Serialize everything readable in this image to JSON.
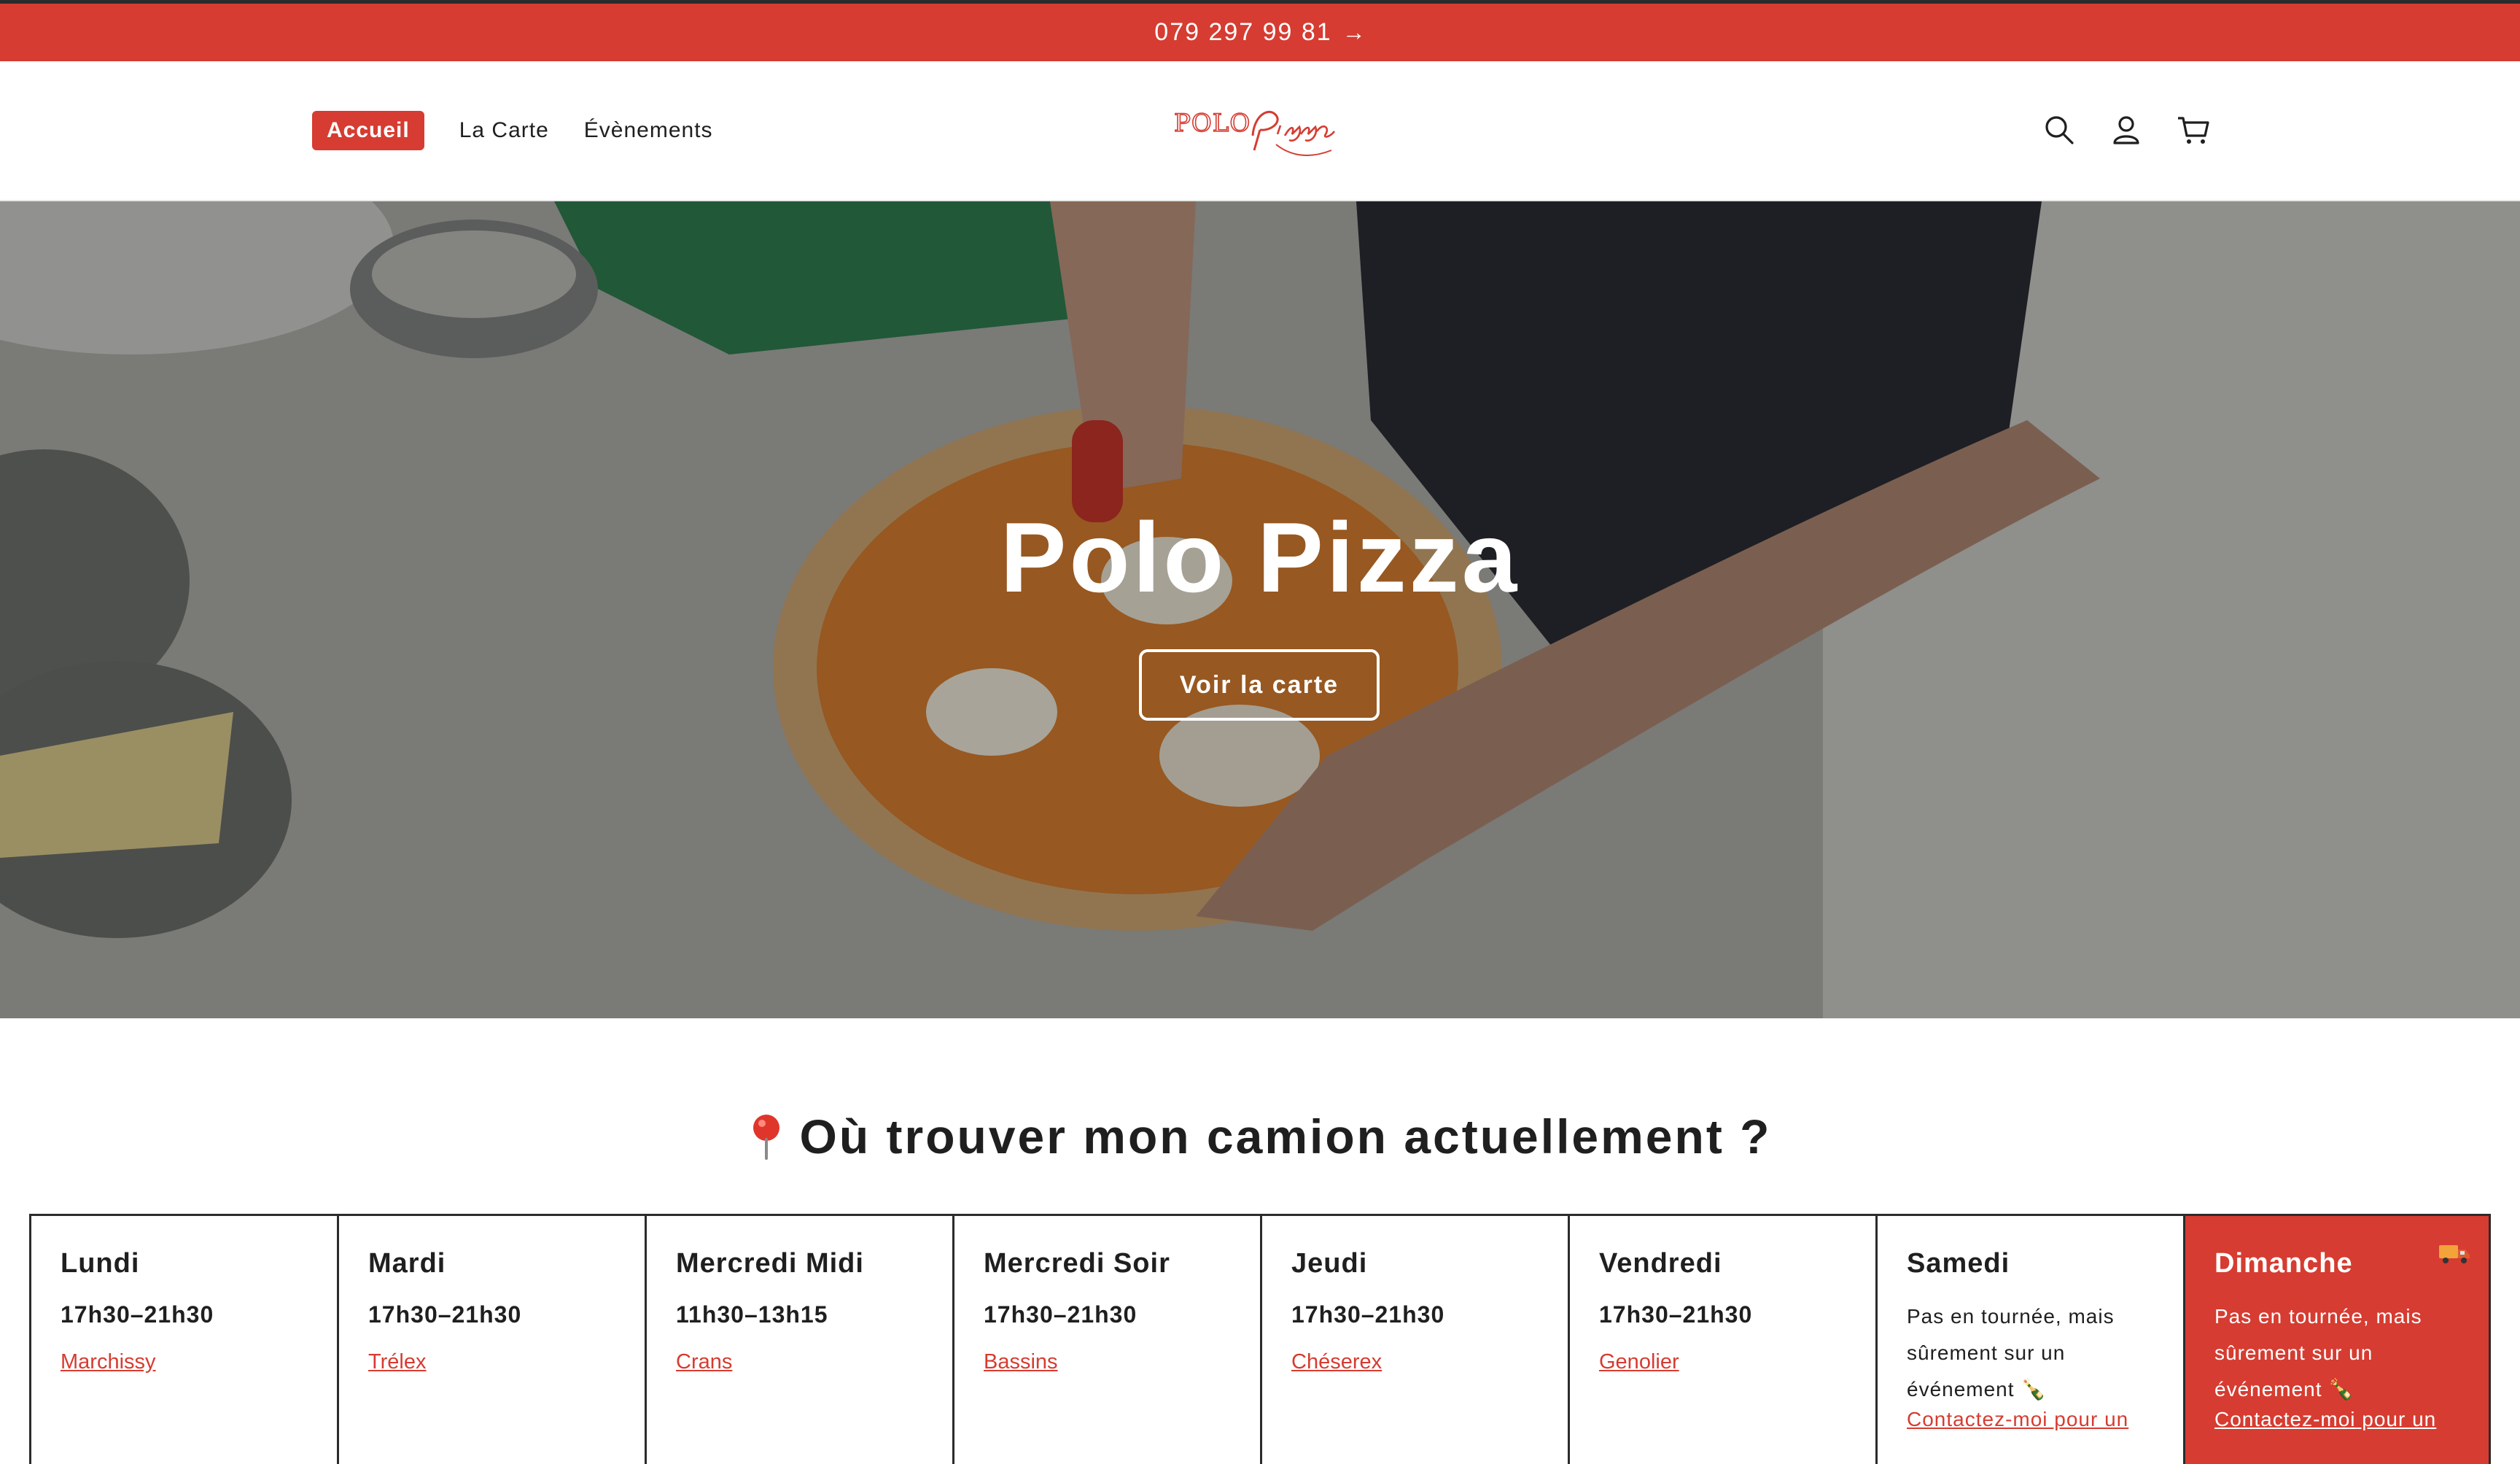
{
  "announcement": {
    "text": "079 297 99 81",
    "arrow": "→"
  },
  "nav": {
    "items": [
      {
        "label": "Accueil",
        "active": true
      },
      {
        "label": "La Carte",
        "active": false
      },
      {
        "label": "Évènements",
        "active": false
      }
    ]
  },
  "logo": {
    "text": "POLO Pizza"
  },
  "header_icons": [
    "search-icon",
    "account-icon",
    "cart-icon"
  ],
  "hero": {
    "title": "Polo Pizza",
    "button_label": "Voir la carte"
  },
  "locations": {
    "heading": "Où trouver mon camion actuellement ?",
    "heading_icon": "pin-icon",
    "days": [
      {
        "name": "Lundi",
        "hours": "17h30–21h30",
        "place": "Marchissy"
      },
      {
        "name": "Mardi",
        "hours": "17h30–21h30",
        "place": "Trélex"
      },
      {
        "name": "Mercredi Midi",
        "hours": "11h30–13h15",
        "place": "Crans"
      },
      {
        "name": "Mercredi Soir",
        "hours": "17h30–21h30",
        "place": "Bassins"
      },
      {
        "name": "Jeudi",
        "hours": "17h30–21h30",
        "place": "Chéserex"
      },
      {
        "name": "Vendredi",
        "hours": "17h30–21h30",
        "place": "Genolier"
      },
      {
        "name": "Samedi",
        "note_lines": [
          "Pas en tournée, mais",
          "sûrement sur un",
          "événement 🍾"
        ],
        "contact": "Contactez-moi pour un"
      },
      {
        "name": "Dimanche",
        "note_lines": [
          "Pas en tournée, mais",
          "sûrement sur un",
          "événement 🍾"
        ],
        "contact": "Contactez-moi pour un",
        "highlight": true,
        "icon": "truck-icon"
      }
    ]
  },
  "colors": {
    "accent": "#d63c31",
    "text": "#1f1f1f",
    "white": "#ffffff"
  }
}
